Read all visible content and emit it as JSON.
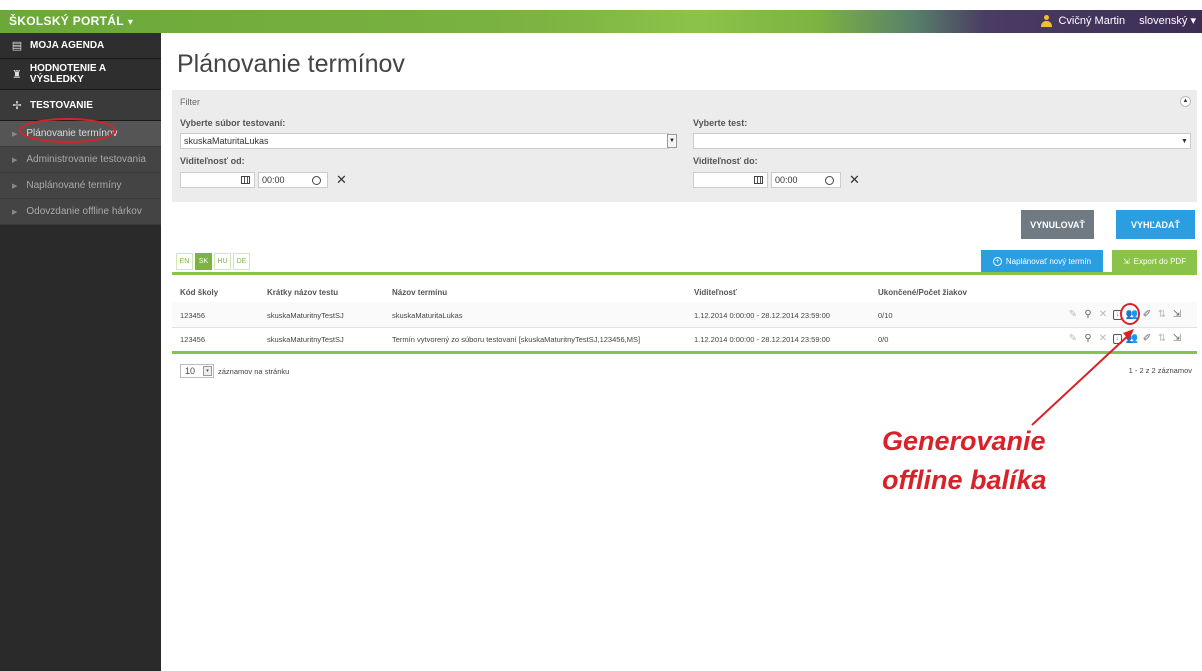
{
  "topbar": {
    "brand": "ŠKOLSKÝ PORTÁL",
    "brand_caret": "▾",
    "user_name": "Cvičný Martin",
    "language": "slovenský",
    "language_caret": "▾"
  },
  "sidebar": {
    "main_items": [
      {
        "label": "MOJA AGENDA",
        "icon": "agenda-icon"
      },
      {
        "label": "HODNOTENIE A VÝSLEDKY",
        "icon": "trophy-icon"
      },
      {
        "label": "TESTOVANIE",
        "icon": "testing-icon"
      }
    ],
    "sub_items": [
      {
        "label": "Plánovanie termínov"
      },
      {
        "label": "Administrovanie testovania"
      },
      {
        "label": "Naplánované termíny"
      },
      {
        "label": "Odovzdanie offline hárkov"
      }
    ]
  },
  "page": {
    "title": "Plánovanie termínov"
  },
  "filter": {
    "heading": "Filter",
    "set_label": "Vyberte súbor testovaní:",
    "set_value": "skuskaMaturitaLukas",
    "test_label": "Vyberte test:",
    "test_value": "",
    "from_label": "Viditeľnosť od:",
    "from_time": "00:00",
    "to_label": "Viditeľnosť do:",
    "to_time": "00:00",
    "clear_symbol": "✕",
    "collapse_symbol": "▲"
  },
  "buttons": {
    "reset": "VYNULOVAŤ",
    "search": "VYHĽADAŤ",
    "plan_new": "Naplánovať nový termín",
    "plan_plus": "+",
    "export_pdf": "Export do PDF"
  },
  "languages": [
    "EN",
    "SK",
    "HU",
    "DE"
  ],
  "active_language": "SK",
  "table": {
    "headers": [
      "Kód školy",
      "Krátky názov testu",
      "Názov termínu",
      "Viditeľnosť",
      "Ukončené/Počet žiakov"
    ],
    "rows": [
      [
        "123456",
        "skuskaMaturitnyTestSJ",
        "skuskaMaturitaLukas",
        "1.12.2014 0:00:00 - 28.12.2014 23:59:00",
        "0/10"
      ],
      [
        "123456",
        "skuskaMaturitnyTestSJ",
        "Termín vytvorený zo súboru testovaní [skuskaMaturitnyTestSJ,123456,MS]",
        "1.12.2014 0:00:00 - 28.12.2014 23:59:00",
        "0/0"
      ]
    ],
    "row_action_icons": [
      "edit-icon",
      "search-icon",
      "delete-icon",
      "generate-offline-package-icon",
      "students-icon",
      "notes-icon",
      "sort-icon",
      "export-icon"
    ]
  },
  "pager": {
    "page_size": "10",
    "page_size_caret": "▾",
    "per_page_label": "záznamov na stránku",
    "summary": "1 - 2 z 2 záznamov"
  },
  "annotation": {
    "line1": "Generovanie",
    "line2": "offline balíka",
    "color": "#d8222a"
  },
  "colors": {
    "accent_green": "#7cb342",
    "accent_blue": "#2a9ee0",
    "sidebar_bg": "#2a2a2a"
  }
}
